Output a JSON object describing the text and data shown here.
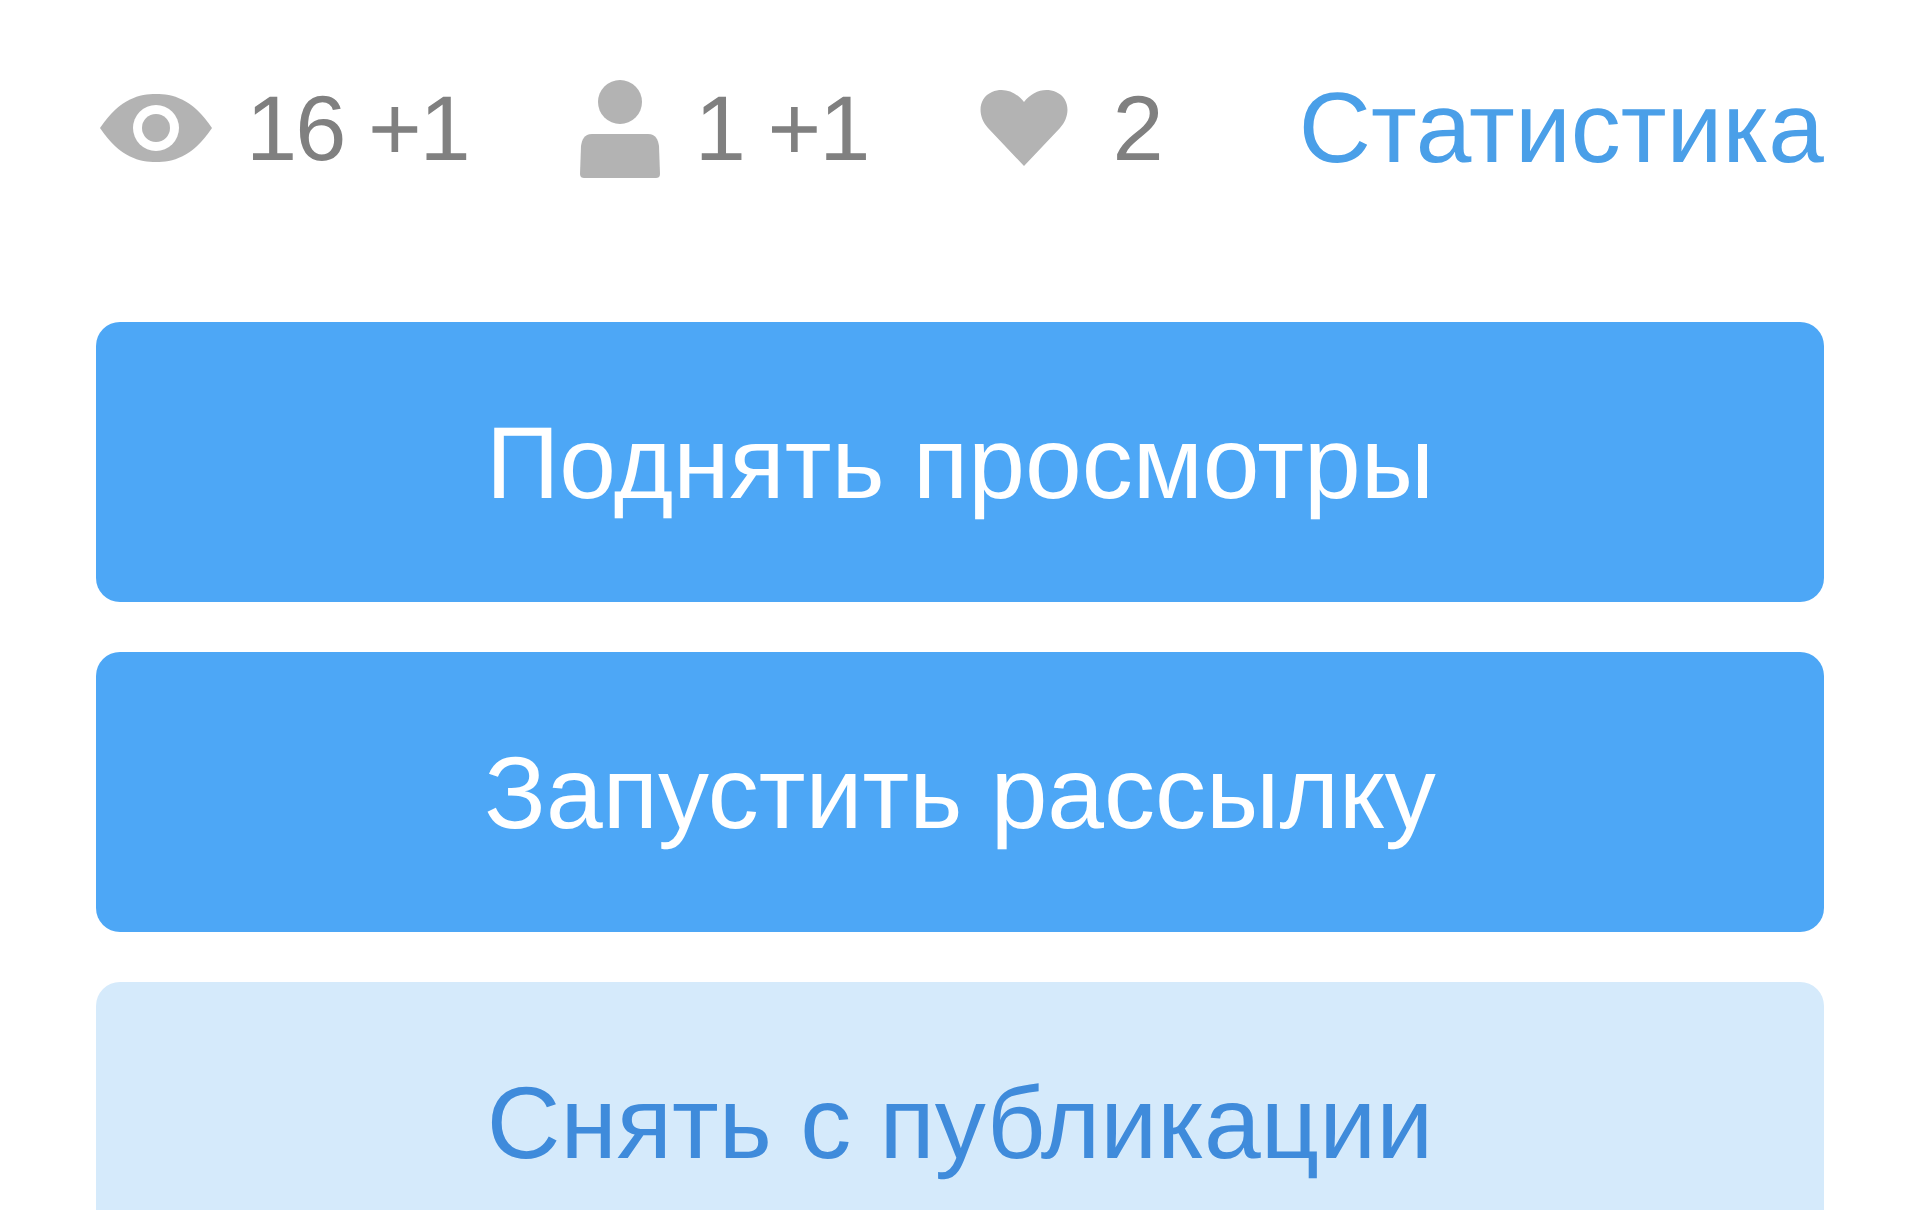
{
  "stats": [
    {
      "kind": "views",
      "value": "16 +1"
    },
    {
      "kind": "visitors",
      "value": "1 +1"
    },
    {
      "kind": "likes",
      "value": "2"
    }
  ],
  "stats_link": "Статистика",
  "buttons": [
    {
      "kind": "primary",
      "label": "Поднять просмотры"
    },
    {
      "kind": "primary",
      "label": "Запустить рассылку"
    },
    {
      "kind": "secondary",
      "label": "Снять с публикации"
    }
  ]
}
